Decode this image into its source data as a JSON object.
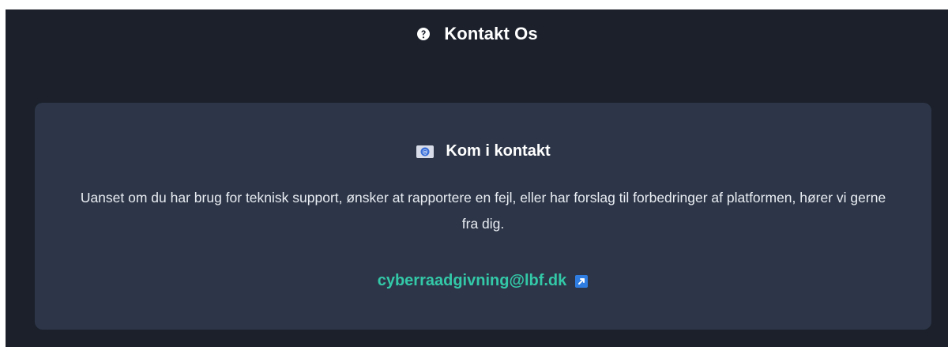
{
  "header": {
    "icon": "question-circle-icon",
    "title": "Kontakt Os"
  },
  "card": {
    "icon": "email-icon",
    "title": "Kom i kontakt",
    "body": "Uanset om du har brug for teknisk support, ønsker at rapportere en fejl, eller har forslag til forbedringer af platformen, hører vi gerne fra dig.",
    "email": "cyberraadgivning@lbf.dk",
    "link_icon": "external-link-icon"
  },
  "colors": {
    "page_background": "#1b202b",
    "card_background": "#2d3648",
    "text": "#e9edf3",
    "accent": "#33c9a8",
    "icon_accent": "#2f7de1"
  }
}
